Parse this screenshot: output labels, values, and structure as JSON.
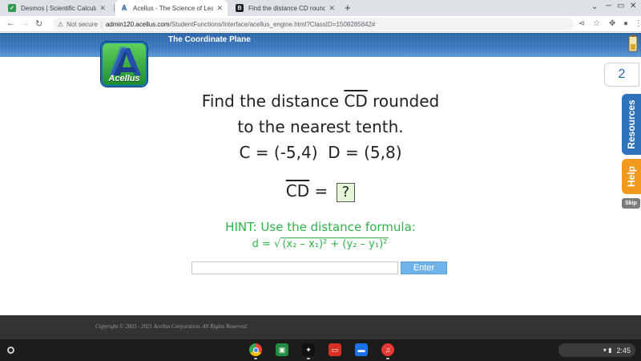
{
  "browser": {
    "tabs": [
      {
        "title": "Desmos | Scientific Calculator",
        "active": false,
        "favicon_color": "#2e9b4e"
      },
      {
        "title": "Acellus - The Science of Learning",
        "active": true,
        "favicon_color": "#2b63a4"
      },
      {
        "title": "Find the distance CD rounded to",
        "active": false,
        "favicon_color": "#202124"
      }
    ],
    "new_tab_label": "+",
    "address": {
      "security_label": "Not secure",
      "host": "admin120.acellus.com",
      "path": "/StudentFunctions/Interface/acellus_engine.html?ClassID=1508285842#"
    }
  },
  "header": {
    "course_title": "The Coordinate Plane"
  },
  "logo": {
    "text": "Acellus"
  },
  "sidebar": {
    "question_number": "2",
    "resources_label": "Resources",
    "help_label": "Help",
    "skip_label": "Skip"
  },
  "problem": {
    "line1_prefix": "Find the distance",
    "segment": "CD",
    "line1_suffix": "rounded",
    "line2": "to the nearest tenth.",
    "points": "C = (-5,4)  D = (5,8)",
    "equals": "=",
    "answer_placeholder": "?",
    "hint_title": "HINT: Use the distance formula:",
    "hint_formula_lhs": "d =",
    "hint_formula_rhs": "(x₂ – x₁)² + (y₂ – y₁)²"
  },
  "input": {
    "value": "",
    "enter_label": "Enter"
  },
  "footer": {
    "copyright": "Copyright © 2003 - 2021 Acellus Corporation.  All Rights Reserved."
  },
  "shelf": {
    "apps": [
      "chrome",
      "classroom",
      "brain-app",
      "slides",
      "files",
      "music"
    ],
    "time": "2:45"
  },
  "colors": {
    "acellus_blue": "#2b63a4",
    "hint_green": "#2fb34a",
    "help_orange": "#f29a1e",
    "enter_blue": "#6fb3e8"
  }
}
